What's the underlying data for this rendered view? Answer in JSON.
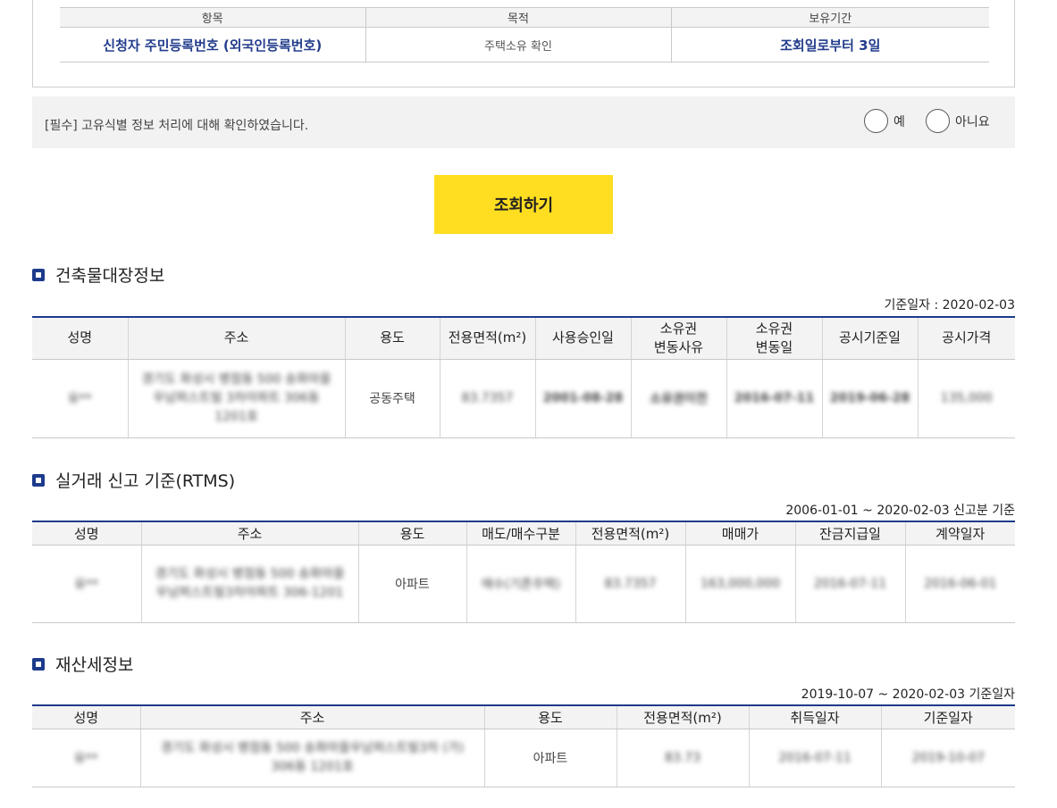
{
  "consent": {
    "headers": [
      "항목",
      "목적",
      "보유기간"
    ],
    "item": "신청자 주민등록번호 (외국인등록번호)",
    "purpose": "주택소유 확인",
    "retention": "조회일로부터 3일"
  },
  "confirm": {
    "text": "[필수] 고유식별 정보 처리에 대해 확인하였습니다.",
    "yes_label": "예",
    "no_label": "아니요"
  },
  "inquiry_button": "조회하기",
  "building": {
    "title": "건축물대장정보",
    "basis": "기준일자 : 2020-02-03",
    "headers": [
      "성명",
      "주소",
      "용도",
      "전용면적(m²)",
      "사용승인일",
      "소유권\n변동사유",
      "소유권\n변동일",
      "공시기준일",
      "공시가격"
    ],
    "row": {
      "name": "유**",
      "address": "경기도 화성시 병점동 500 송화마을우남퍼스트빌 3차아파트 306동 1201호",
      "use": "공동주택",
      "area": "83.7357",
      "approval_date": "2001-08-28",
      "change_reason": "소유권이전",
      "change_date": "2016-07-11",
      "notice_date": "2019-06-28",
      "notice_price": "135,000"
    }
  },
  "rtms": {
    "title": "실거래 신고 기준(RTMS)",
    "basis": "2006-01-01 ~ 2020-02-03 신고분 기준",
    "headers": [
      "성명",
      "주소",
      "용도",
      "매도/매수구분",
      "전용면적(m²)",
      "매매가",
      "잔금지급일",
      "계약일자"
    ],
    "row": {
      "name": "유**",
      "address": "경기도 화성시 병점동 500 송화마을우남퍼스트빌3차아파트 306-1201",
      "use": "아파트",
      "trade_type": "매수(기존주택)",
      "area": "83.7357",
      "price": "163,000,000",
      "payment_date": "2016-07-11",
      "contract_date": "2016-06-01"
    }
  },
  "property_tax": {
    "title": "재산세정보",
    "basis": "2019-10-07 ~ 2020-02-03 기준일자",
    "headers": [
      "성명",
      "주소",
      "용도",
      "전용면적(m²)",
      "취득일자",
      "기준일자"
    ],
    "row": {
      "name": "유**",
      "address": "경기도 화성시 병점동 500 송화마을우남퍼스트빌3차 (가) 306동 1201호",
      "use": "아파트",
      "area": "83.73",
      "acquired_date": "2016-07-11",
      "basis_date": "2019-10-07"
    }
  }
}
